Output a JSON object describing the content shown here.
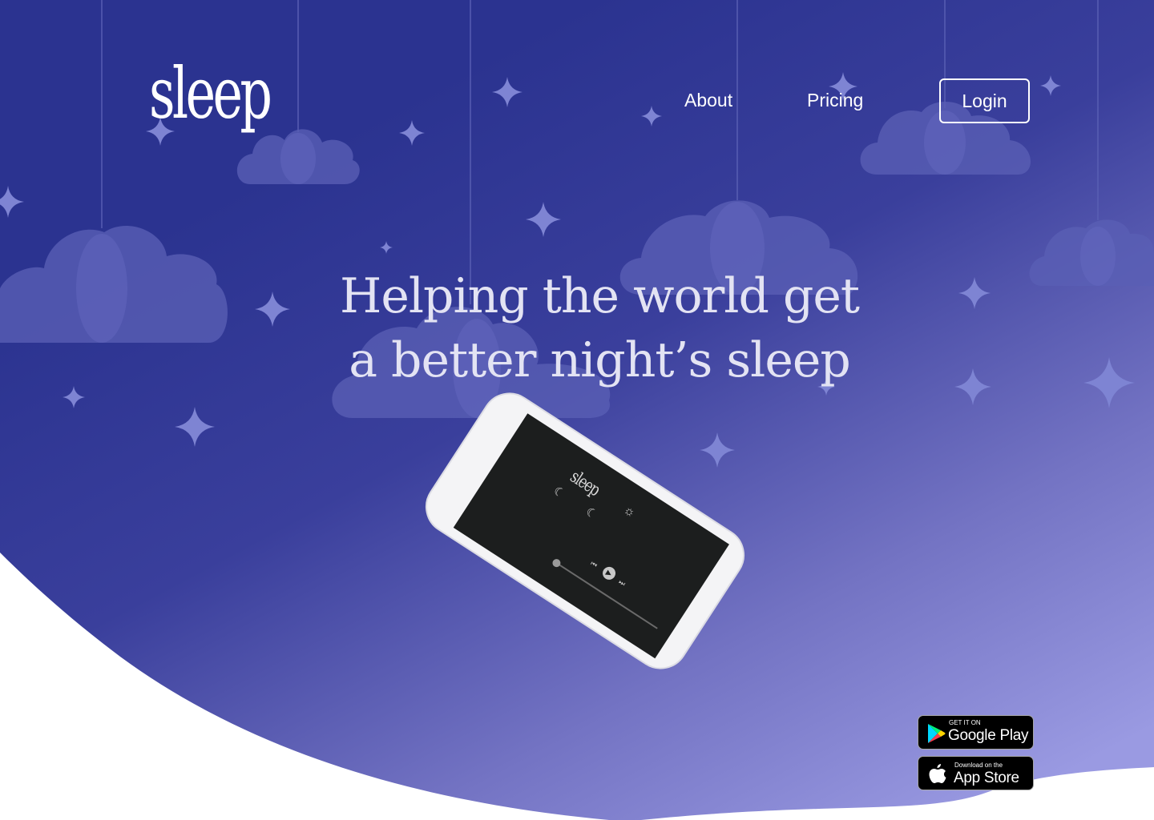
{
  "header": {
    "logo_text": "sleep",
    "nav": {
      "about_label": "About",
      "pricing_label": "Pricing",
      "login_label": "Login"
    }
  },
  "hero": {
    "headline_line1": "Helping the world get",
    "headline_line2": "a better night’s sleep"
  },
  "phone_mockup": {
    "screen_logo_text": "sleep",
    "screen_icons": [
      "sun-icon",
      "cloud-moon-icon",
      "cloud-moon-icon"
    ],
    "player_icons": [
      "previous-icon",
      "play-icon",
      "next-icon"
    ]
  },
  "store_badges": {
    "google_play": {
      "small_text": "GET IT ON",
      "big_text": "Google Play"
    },
    "app_store": {
      "small_text": "Download on the",
      "big_text": "App Store"
    }
  },
  "colors": {
    "sky_top": "#2b3390",
    "sky_bottom": "#9a9ae2",
    "cloud": "#6e6fc4",
    "white": "#ffffff"
  }
}
